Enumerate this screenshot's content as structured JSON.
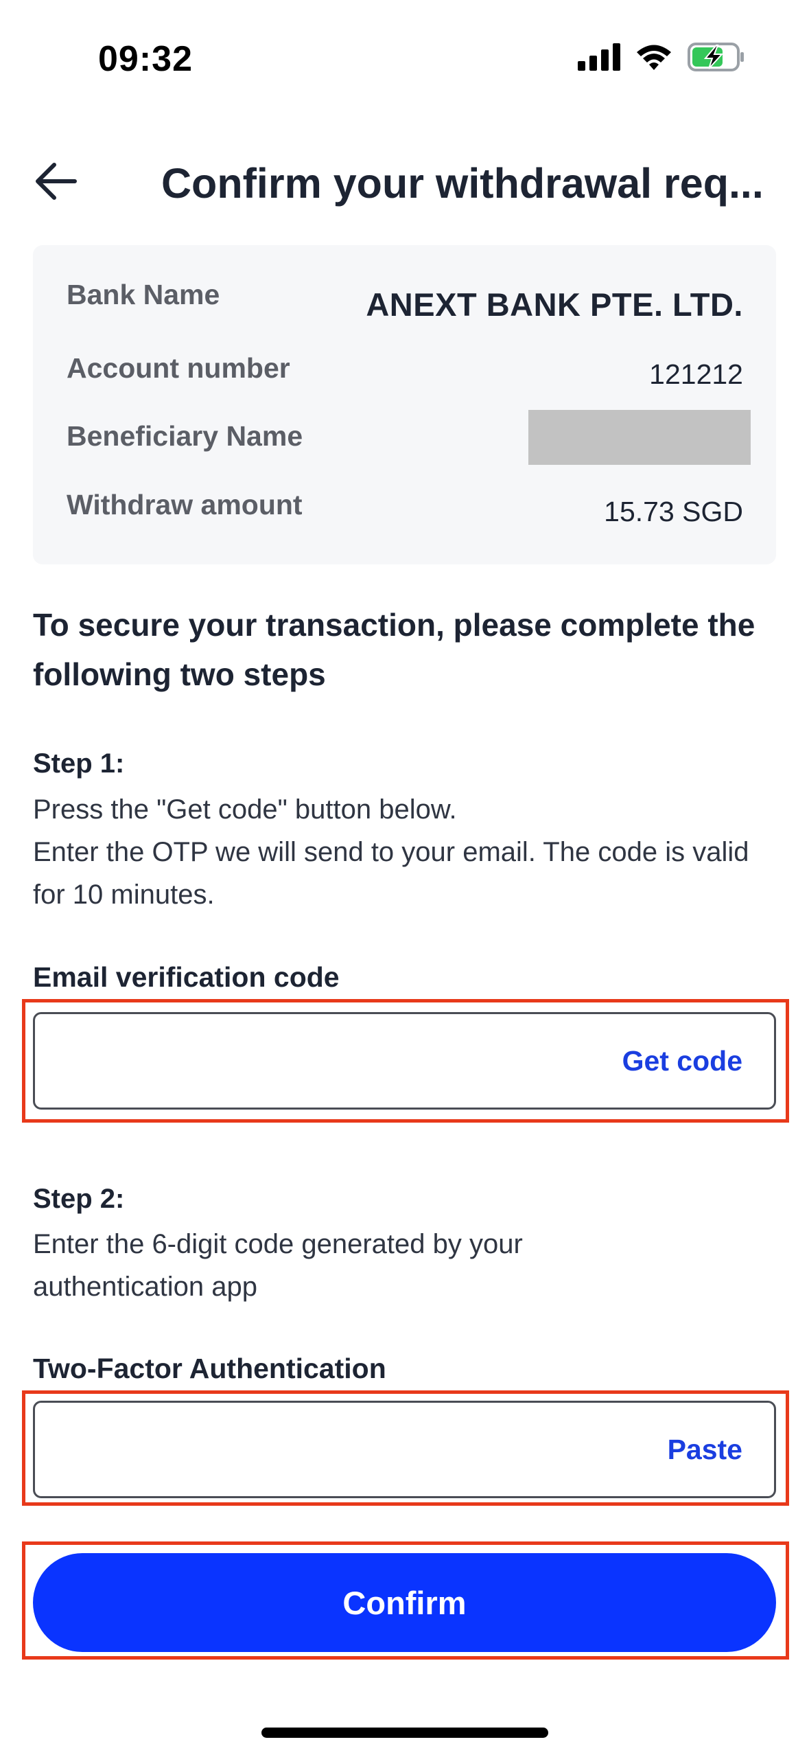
{
  "status_bar": {
    "time": "09:32",
    "icons": [
      "cellular-signal-icon",
      "wifi-icon",
      "battery-charging-icon"
    ]
  },
  "header": {
    "title": "Confirm your withdrawal req...",
    "back_icon": "arrow-left-icon"
  },
  "details": {
    "rows": [
      {
        "label": "Bank Name",
        "value": "ANEXT BANK PTE. LTD."
      },
      {
        "label": "Account number",
        "value": "121212"
      },
      {
        "label": "Beneficiary Name",
        "value": ""
      },
      {
        "label": "Withdraw amount",
        "value": "15.73 SGD"
      }
    ]
  },
  "instructions": {
    "heading": "To secure your transaction, please complete the following two steps"
  },
  "step1": {
    "title": "Step 1:",
    "line1": "Press the \"Get code\" button below.",
    "line2": "Enter the OTP we will send to your email. The code is valid for 10 minutes.",
    "field_label": "Email verification code",
    "field_value": "",
    "action": "Get code"
  },
  "step2": {
    "title": "Step 2:",
    "text": "Enter the 6-digit code generated by your authentication app",
    "field_label": "Two-Factor Authentication",
    "field_value": "",
    "action": "Paste"
  },
  "confirm_button": {
    "label": "Confirm"
  },
  "colors": {
    "accent": "#0a34ff",
    "link": "#1a3ee0",
    "highlight": "#e8391a",
    "card_bg": "#f6f7f9",
    "text": "#1d2433"
  }
}
